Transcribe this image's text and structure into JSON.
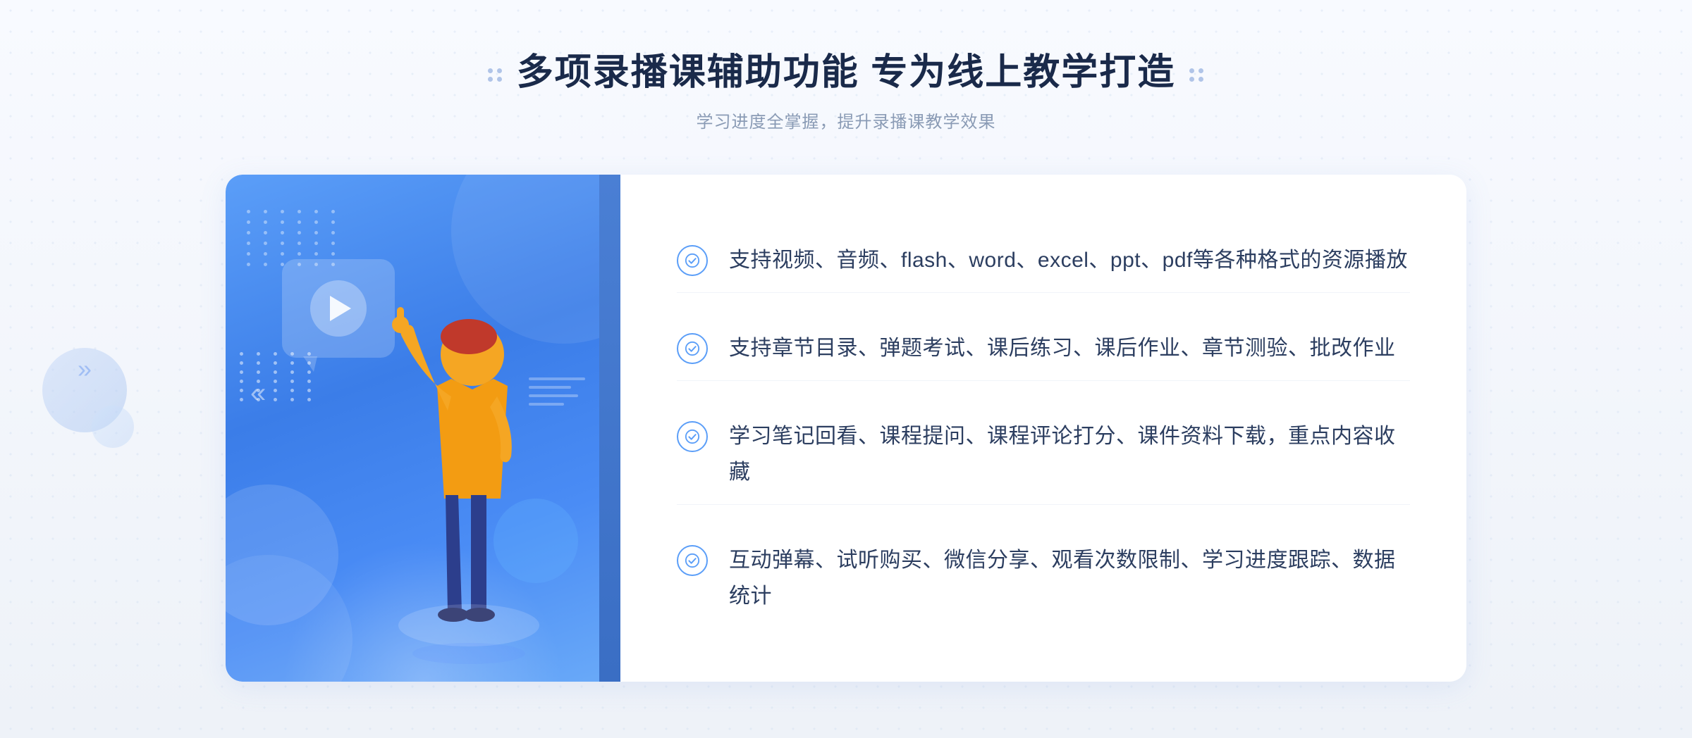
{
  "header": {
    "title": "多项录播课辅助功能 专为线上教学打造",
    "subtitle": "学习进度全掌握，提升录播课教学效果",
    "deco_dots_count": 4
  },
  "features": [
    {
      "id": "feature-1",
      "text": "支持视频、音频、flash、word、excel、ppt、pdf等各种格式的资源播放"
    },
    {
      "id": "feature-2",
      "text": "支持章节目录、弹题考试、课后练习、课后作业、章节测验、批改作业"
    },
    {
      "id": "feature-3",
      "text": "学习笔记回看、课程提问、课程评论打分、课件资料下载，重点内容收藏"
    },
    {
      "id": "feature-4",
      "text": "互动弹幕、试听购买、微信分享、观看次数限制、学习进度跟踪、数据统计"
    }
  ],
  "illustration": {
    "play_button_label": "play",
    "dots_rows": 6,
    "dots_cols": 5
  },
  "colors": {
    "accent_blue": "#5b9ef8",
    "dark_blue": "#3a6ec4",
    "text_dark": "#2c3e60",
    "text_light": "#8a9bb5",
    "bg_light": "#f5f7fa"
  }
}
